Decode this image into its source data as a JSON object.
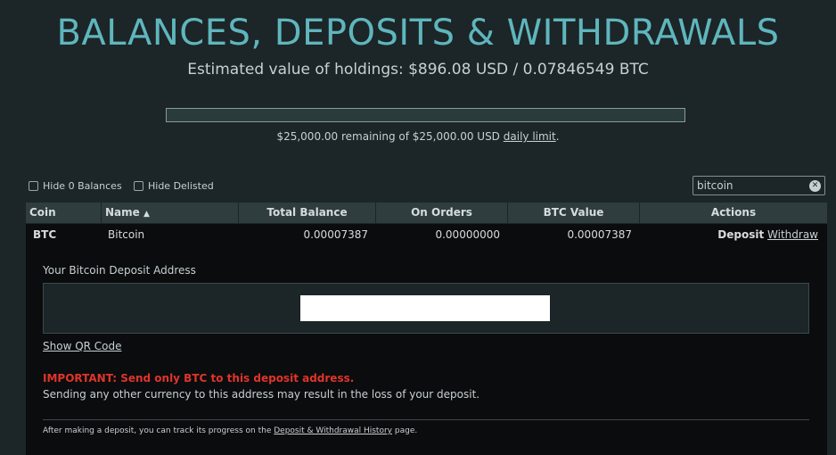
{
  "page": {
    "title": "BALANCES, DEPOSITS & WITHDRAWALS",
    "estimated_label": "Estimated value of holdings: $896.08 USD / 0.07846549 BTC"
  },
  "limit": {
    "remaining_text": "$25,000.00 remaining of $25,000.00 USD",
    "link_text": "daily limit",
    "suffix": ".",
    "used_fraction": 0
  },
  "filters": {
    "hide_zero_label": "Hide 0 Balances",
    "hide_delisted_label": "Hide Delisted",
    "search_value": "bitcoin",
    "clear_icon": "x-icon"
  },
  "table": {
    "headers": {
      "coin": "Coin",
      "name": "Name",
      "sort_arrow": "▲",
      "total_balance": "Total Balance",
      "on_orders": "On Orders",
      "btc_value": "BTC Value",
      "actions": "Actions"
    },
    "rows": [
      {
        "coin": "BTC",
        "name": "Bitcoin",
        "total_balance": "0.00007387",
        "on_orders": "0.00000000",
        "btc_value": "0.00007387",
        "deposit_label": "Deposit",
        "withdraw_label": "Withdraw"
      }
    ]
  },
  "deposit_panel": {
    "address_label": "Your Bitcoin Deposit Address",
    "address_value": "",
    "qr_link": "Show QR Code",
    "important": "IMPORTANT: Send only BTC to this deposit address.",
    "warning": "Sending any other currency to this address may result in the loss of your deposit.",
    "footnote_prefix": "After making a deposit, you can track its progress on the",
    "footnote_link": "Deposit & Withdrawal History",
    "footnote_suffix": "page."
  },
  "colors": {
    "background": "#1c2527",
    "title": "#5fb6bd",
    "header_bg": "#2f3d3f",
    "important": "#e0342b"
  }
}
